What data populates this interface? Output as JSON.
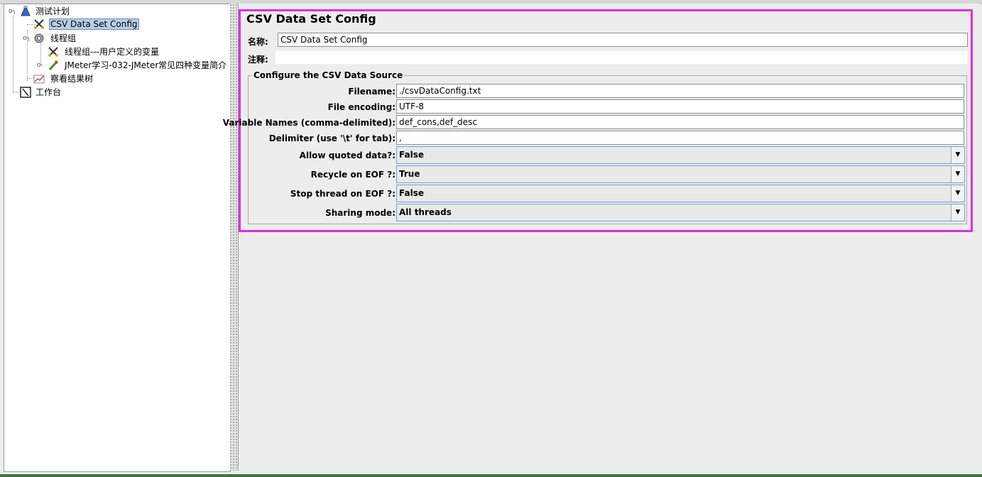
{
  "tree": {
    "nodes": [
      {
        "label": "测试计划",
        "icon": "flask-icon"
      },
      {
        "label": "CSV Data Set Config",
        "icon": "scissors-config-icon"
      },
      {
        "label": "线程组",
        "icon": "gear-icon"
      },
      {
        "label": "线程组---用户定义的变量",
        "icon": "scissors-config-icon"
      },
      {
        "label": "JMeter学习-032-JMeter常见四种变量简介",
        "icon": "sampler-brush-icon"
      },
      {
        "label": "察看结果树",
        "icon": "chart-listener-icon"
      },
      {
        "label": "工作台",
        "icon": "workbench-icon"
      }
    ]
  },
  "panel": {
    "title": "CSV Data Set Config",
    "name_label": "名称:",
    "name_value": "CSV Data Set Config",
    "comment_label": "注释:",
    "comment_value": "",
    "group_title": "Configure the CSV Data Source",
    "fields": {
      "filename": {
        "label": "Filename:",
        "value": "./csvDataConfig.txt"
      },
      "encoding": {
        "label": "File encoding:",
        "value": "UTF-8"
      },
      "varnames": {
        "label": "Variable Names (comma-delimited):",
        "value": "def_cons,def_desc"
      },
      "delimiter": {
        "label": "Delimiter (use '\\t' for tab):",
        "value": ","
      },
      "quoted": {
        "label": "Allow quoted data?:",
        "value": "False"
      },
      "recycle": {
        "label": "Recycle on EOF ?:",
        "value": "True"
      },
      "stopthread": {
        "label": "Stop thread on EOF ?:",
        "value": "False"
      },
      "sharing": {
        "label": "Sharing mode:",
        "value": "All threads"
      }
    }
  },
  "colors": {
    "highlight": "#e02de0",
    "selection": "#b8cfe5"
  }
}
